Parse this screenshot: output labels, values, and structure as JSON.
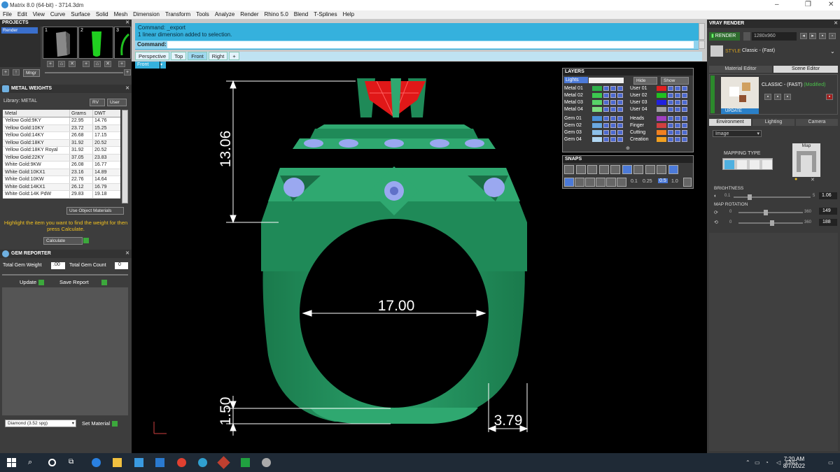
{
  "window": {
    "title": "Matrix 8.0 (64-bit) - 3714.3dm",
    "minimize": "–",
    "restore": "❐",
    "close": "✕"
  },
  "menu": [
    "File",
    "Edit",
    "View",
    "Curve",
    "Surface",
    "Solid",
    "Mesh",
    "Dimension",
    "Transform",
    "Tools",
    "Analyze",
    "Render",
    "Rhino 5.0",
    "Blend",
    "T-Splines",
    "Help"
  ],
  "projects": {
    "title": "PROJECTS",
    "item": "Render",
    "thumb_numbers": [
      "1",
      "2",
      "3"
    ],
    "mngr": "Mngr"
  },
  "metal_weights": {
    "title": "METAL WEIGHTS",
    "library_label": "Library: METAL",
    "library_buttons": [
      "RV",
      "User"
    ],
    "columns": [
      "Metal",
      "Grams",
      "DWT"
    ],
    "rows": [
      [
        "Yellow Gold:9KY",
        "22.95",
        "14.76"
      ],
      [
        "Yellow Gold:10KY",
        "23.72",
        "15.25"
      ],
      [
        "Yellow Gold:14KY",
        "26.68",
        "17.15"
      ],
      [
        "Yellow Gold:18KY",
        "31.92",
        "20.52"
      ],
      [
        "Yellow Gold:18KY Royal",
        "31.92",
        "20.52"
      ],
      [
        "Yellow Gold:22KY",
        "37.05",
        "23.83"
      ],
      [
        "White Gold:9KW",
        "26.08",
        "16.77"
      ],
      [
        "White Gold:10KX1",
        "23.16",
        "14.89"
      ],
      [
        "White Gold:10KW",
        "22.76",
        "14.64"
      ],
      [
        "White Gold:14KX1",
        "26.12",
        "16.79"
      ],
      [
        "White Gold:14K PdW",
        "29.83",
        "19.18"
      ]
    ],
    "use_object_materials": "Use Object Materials",
    "hint": "Highlight the item you want to find the weight for then press Calculate.",
    "calculate": "Calculate"
  },
  "gem_reporter": {
    "title": "GEM REPORTER",
    "total_weight_label": "Total Gem Weight",
    "total_weight": ".00",
    "total_count_label": "Total Gem Count",
    "total_count": "0",
    "update": "Update",
    "save_report": "Save Report",
    "material": "Diamond    (3.52 spg)",
    "set_material": "Set Material"
  },
  "command": {
    "line1": "Command: _export",
    "line2": "1 linear dimension added to selection.",
    "label": "Command:"
  },
  "viewport_tabs": [
    "Perspective",
    "Top",
    "Front",
    "Right",
    "+"
  ],
  "active_view": "Front",
  "dimensions": {
    "height": "13.06",
    "inner_diameter": "17.00",
    "bottom": "1.50",
    "width": "3.79"
  },
  "layers": {
    "title": "LAYERS",
    "lights": "Lights",
    "hide": "Hide",
    "show": "Show",
    "left": [
      {
        "name": "Metal 01",
        "color": "#2eb04a"
      },
      {
        "name": "Metal 02",
        "color": "#3cc850"
      },
      {
        "name": "Metal 03",
        "color": "#58d268"
      },
      {
        "name": "Metal 04",
        "color": "#7edc80"
      },
      {
        "name": "Gem 01",
        "color": "#4a90d8"
      },
      {
        "name": "Gem 02",
        "color": "#6aa8e0"
      },
      {
        "name": "Gem 03",
        "color": "#8cc0ea"
      },
      {
        "name": "Gem 04",
        "color": "#b0d6f2"
      }
    ],
    "right": [
      {
        "name": "User 01",
        "color": "#e02020"
      },
      {
        "name": "User 02",
        "color": "#20c020"
      },
      {
        "name": "User 03",
        "color": "#2020e0"
      },
      {
        "name": "User 04",
        "color": "#a0a0a0"
      },
      {
        "name": "Heads",
        "color": "#a040c0"
      },
      {
        "name": "Finger",
        "color": "#d04040"
      },
      {
        "name": "Cutting",
        "color": "#f08020"
      },
      {
        "name": "Creation",
        "color": "#f0a020"
      }
    ]
  },
  "snaps": {
    "title": "SNAPS",
    "values": [
      "0.1",
      "0.25",
      "0.5",
      "1.0"
    ]
  },
  "vray": {
    "title": "VRAY RENDER",
    "render": "RENDER",
    "resolution": "1280x960",
    "style_label": "STYLE",
    "style": "Classic - (Fast)",
    "tabs": [
      "Material Editor",
      "Scene Editor"
    ],
    "preset": "CLASSIC - (FAST)",
    "modified": "(Modified)",
    "update": "UPDATE",
    "env_tabs": [
      "Environment",
      "Lighting",
      "Camera"
    ],
    "image_select": "Image",
    "mapping_type": "MAPPING TYPE",
    "map_label": "Map",
    "brightness_label": "BRIGHTNESS",
    "brightness_min": "0.1",
    "brightness_max": "5",
    "brightness": "1.06",
    "rotation_label": "MAP ROTATION",
    "rot_min": "0",
    "rot_max": "360",
    "rotation1": "149",
    "rotation2": "188"
  },
  "taskbar": {
    "lang": "ENG",
    "time": "7:20 AM",
    "date": "8/7/2022"
  },
  "colors": {
    "ring": "#1f8a58",
    "ring_light": "#2fa870",
    "gem_blue": "#9aa8f0",
    "ruby": "#e01818",
    "accent": "#35b1dd"
  }
}
